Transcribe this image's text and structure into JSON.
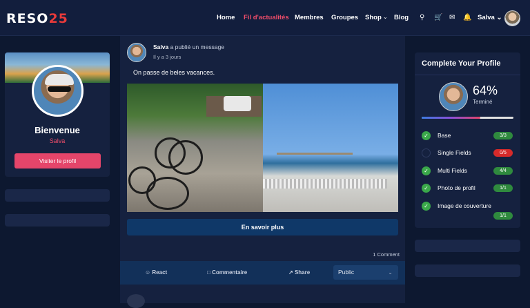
{
  "header": {
    "logo_main": "RESO",
    "logo_accent": "25",
    "nav": [
      "Home",
      "Fil d'actualités",
      "Membres",
      "Groupes",
      "Shop",
      "Blog"
    ],
    "active_nav": "Fil d'actualités",
    "user_name": "Salva"
  },
  "left_card": {
    "welcome": "Bienvenue",
    "user": "Salva",
    "button": "Visiter le profil"
  },
  "post": {
    "author": "Salva",
    "action": "a publié un message",
    "time": "Il y a 3 jours",
    "text": "On passe de beles vacances.",
    "more_button": "En savoir plus",
    "comments": "1 Comment",
    "actions": {
      "react": "React",
      "comment": "Commentaire",
      "share": "Share",
      "visibility": "Public"
    }
  },
  "profile_widget": {
    "title": "Complete Your Profile",
    "percent": "64%",
    "percent_value": 64,
    "status": "Terminé",
    "items": [
      {
        "label": "Base",
        "progress": "3/3",
        "complete": true
      },
      {
        "label": "Single Fields",
        "progress": "0/5",
        "complete": false
      },
      {
        "label": "Multi Fields",
        "progress": "4/4",
        "complete": true
      },
      {
        "label": "Photo de profil",
        "progress": "1/1",
        "complete": true
      },
      {
        "label": "Image de couverture",
        "progress": "1/1",
        "complete": true
      }
    ]
  },
  "colors": {
    "accent": "#e5456a",
    "background": "#0d1830",
    "card": "#15213f"
  }
}
